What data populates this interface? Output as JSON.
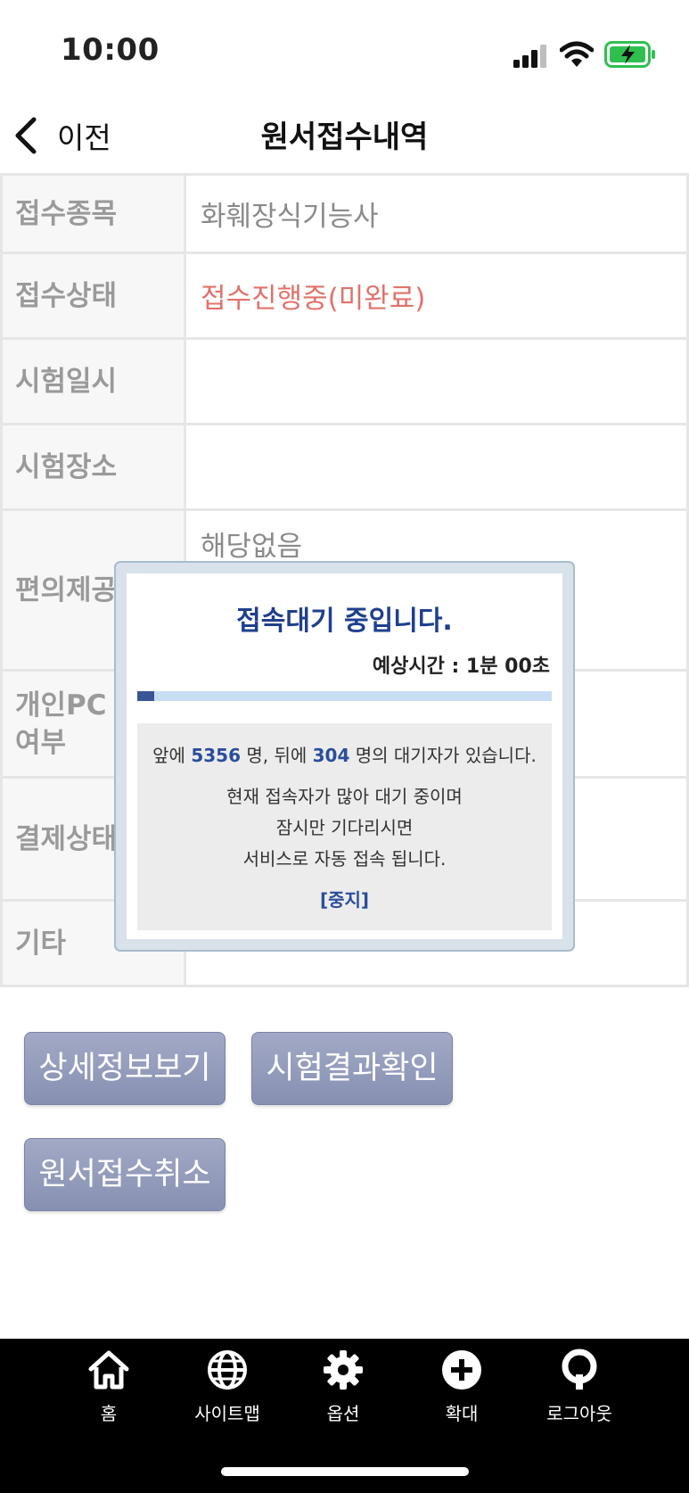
{
  "status_bar": {
    "time": "10:00"
  },
  "nav": {
    "back_label": "이전",
    "title": "원서접수내역"
  },
  "table": {
    "rows": [
      {
        "label": "접수종목",
        "value": "화훼장식기능사"
      },
      {
        "label": "접수상태",
        "value": "접수진행중(미완료)"
      },
      {
        "label": "시험일시",
        "value": ""
      },
      {
        "label": "시험장소",
        "value": ""
      },
      {
        "label": "편의제공",
        "value": "해당없음"
      },
      {
        "label": "개인PC 여부",
        "value": ""
      },
      {
        "label": "결제상태",
        "value": ""
      },
      {
        "label": "기타",
        "value": ""
      }
    ]
  },
  "buttons": {
    "detail": "상세정보보기",
    "result": "시험결과확인",
    "cancel": "원서접수취소"
  },
  "modal": {
    "title": "접속대기 중입니다.",
    "eta_label": "예상시간 : 1분 00초",
    "progress": 0.04,
    "ahead_prefix": "앞에",
    "ahead_count": "5356",
    "ahead_mid": "명, 뒤에",
    "behind_count": "304",
    "behind_suffix": "명의 대기자가 있습니다.",
    "message_line1": "현재 접속자가 많아 대기 중이며",
    "message_line2": "잠시만 기다리시면",
    "message_line3": "서비스로 자동 접속 됩니다.",
    "stop_label": "[중지]"
  },
  "tab_bar": {
    "items": [
      {
        "label": "홈",
        "icon": "home-icon"
      },
      {
        "label": "사이트맵",
        "icon": "globe-icon"
      },
      {
        "label": "옵션",
        "icon": "gear-icon"
      },
      {
        "label": "확대",
        "icon": "plus-circle-icon"
      },
      {
        "label": "로그아웃",
        "icon": "logout-icon"
      }
    ]
  },
  "colors": {
    "status_red": "#e0736b",
    "modal_title": "#1f3f8f",
    "button_bg": "#8f98b8",
    "progress_fill": "#3a5596",
    "progress_track": "#c7ddf4"
  }
}
